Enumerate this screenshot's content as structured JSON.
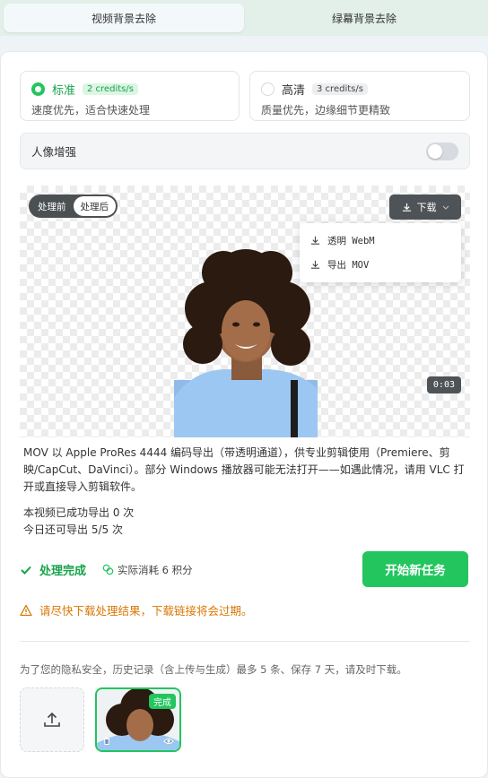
{
  "tabs": [
    {
      "label": "视频背景去除"
    },
    {
      "label": "绿幕背景去除"
    }
  ],
  "modes": {
    "standard": {
      "title": "标准",
      "credits": "2 credits/s",
      "desc": "速度优先，适合快速处理"
    },
    "hd": {
      "title": "高清",
      "credits": "3 credits/s",
      "desc": "质量优先，边缘细节更精致"
    }
  },
  "enhance": {
    "label": "人像增强",
    "enabled": false
  },
  "preview": {
    "segment": {
      "before": "处理前",
      "after": "处理后",
      "selected": "处理后"
    },
    "download": {
      "label": "下载",
      "menu": [
        {
          "label": "透明 WebM"
        },
        {
          "label": "导出 MOV"
        }
      ]
    },
    "time": "0:03"
  },
  "info": {
    "text": "MOV 以 Apple ProRes 4444 编码导出（带透明通道），供专业剪辑使用（Premiere、剪映/CapCut、DaVinci）。部分 Windows 播放器可能无法打开——如遇此情况，请用 VLC 打开或直接导入剪辑软件。",
    "export_count": "本视频已成功导出 0 次",
    "remaining": "今日还可导出 5/5 次"
  },
  "status": {
    "done": "处理完成",
    "cost": "实际消耗 6 积分"
  },
  "new_task": "开始新任务",
  "warning": "请尽快下载处理结果，下载链接将会过期。",
  "privacy": "为了您的隐私安全，历史记录（含上传与生成）最多 5 条、保存 7 天，请及时下载。",
  "history": {
    "badge": "完成"
  },
  "colors": {
    "accent": "#22c55e",
    "warning": "#d97706"
  }
}
